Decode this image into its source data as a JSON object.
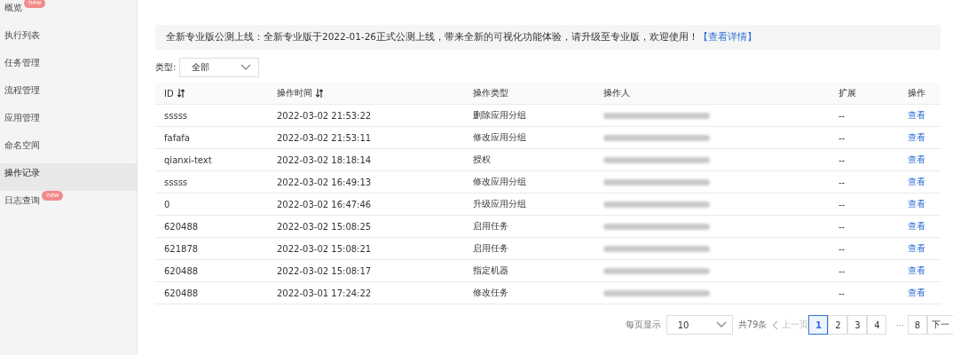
{
  "sidebar": {
    "items": [
      {
        "label": "概览",
        "selected": false,
        "badge": "new"
      },
      {
        "label": "执行列表",
        "selected": false
      },
      {
        "label": "任务管理",
        "selected": false
      },
      {
        "label": "流程管理",
        "selected": false
      },
      {
        "label": "应用管理",
        "selected": false
      },
      {
        "label": "命名空间",
        "selected": false
      },
      {
        "label": "操作记录",
        "selected": true
      },
      {
        "label": "日志查询",
        "selected": false,
        "badge": "new"
      }
    ]
  },
  "notice": {
    "text": "全新专业版公测上线：全新专业版于2022-01-26正式公测上线，带来全新的可视化功能体验，请升级至专业版，欢迎使用！",
    "link": "【查看详情】"
  },
  "filter": {
    "label": "类型:",
    "value": "全部"
  },
  "table": {
    "columns": [
      {
        "label": "ID",
        "sortable": true
      },
      {
        "label": "操作时间",
        "sortable": true
      },
      {
        "label": "操作类型",
        "sortable": false
      },
      {
        "label": "操作人",
        "sortable": false
      },
      {
        "label": "扩展",
        "sortable": false
      },
      {
        "label": "操作",
        "sortable": false
      }
    ],
    "rows": [
      {
        "id": "sssss",
        "time": "2022-03-02 21:53:22",
        "type": "删除应用分组",
        "extension": "--",
        "action": "查看"
      },
      {
        "id": "fafafa",
        "time": "2022-03-02 21:53:11",
        "type": "修改应用分组",
        "extension": "--",
        "action": "查看"
      },
      {
        "id": "qianxi-text",
        "time": "2022-03-02 18:18:14",
        "type": "授权",
        "extension": "--",
        "action": "查看"
      },
      {
        "id": "sssss",
        "time": "2022-03-02 16:49:13",
        "type": "修改应用分组",
        "extension": "--",
        "action": "查看"
      },
      {
        "id": "0",
        "time": "2022-03-02 16:47:46",
        "type": "升级应用分组",
        "extension": "--",
        "action": "查看"
      },
      {
        "id": "620488",
        "time": "2022-03-02 15:08:25",
        "type": "启用任务",
        "extension": "--",
        "action": "查看"
      },
      {
        "id": "621878",
        "time": "2022-03-02 15:08:21",
        "type": "启用任务",
        "extension": "--",
        "action": "查看"
      },
      {
        "id": "620488",
        "time": "2022-03-02 15:08:17",
        "type": "指定机器",
        "extension": "--",
        "action": "查看"
      },
      {
        "id": "620488",
        "time": "2022-03-01 17:24:22",
        "type": "修改任务",
        "extension": "--",
        "action": "查看"
      }
    ]
  },
  "pagination": {
    "page_size_label": "每页显示",
    "page_size": "10",
    "total": "共79条",
    "prev": {
      "label": "上一页",
      "disabled": true
    },
    "pages": [
      {
        "label": "1",
        "selected": true
      },
      {
        "label": "2",
        "selected": false
      },
      {
        "label": "3",
        "selected": false
      },
      {
        "label": "4",
        "selected": false
      },
      {
        "label": "···",
        "kind": "ellipsis"
      },
      {
        "label": "8",
        "selected": false
      }
    ],
    "next": {
      "label": "下一",
      "disabled": false
    }
  }
}
